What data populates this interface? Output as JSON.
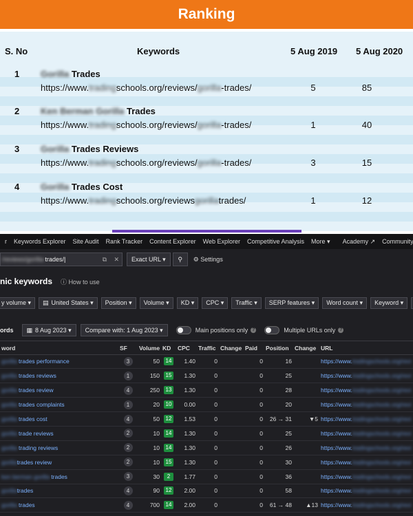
{
  "ranking": {
    "banner": "Ranking",
    "headers": {
      "sno": "S. No",
      "keywords": "Keywords",
      "date1": "5 Aug 2019",
      "date2": "5 Aug 2020"
    },
    "rows": [
      {
        "num": "1",
        "kw_blur": "Gorilla",
        "kw": "Trades",
        "url1": "https://www.",
        "url_blur1": "trading",
        "url2": "schools.org/reviews/",
        "url_blur2": "gorilla",
        "url3": "-trades/",
        "v2019": "5",
        "v2020": "85"
      },
      {
        "num": "2",
        "kw_blur": "Ken Berman Gorilla",
        "kw": "Trades",
        "url1": "https://www.",
        "url_blur1": "trading",
        "url2": "schools.org/reviews/",
        "url_blur2": "gorilla",
        "url3": "-trades/",
        "v2019": "1",
        "v2020": "40"
      },
      {
        "num": "3",
        "kw_blur": "Gorilla",
        "kw": "Trades Reviews",
        "url1": "https://www.",
        "url_blur1": "trading",
        "url2": "schools.org/reviews/",
        "url_blur2": "gorilla",
        "url3": "-trades/",
        "v2019": "3",
        "v2020": "15"
      },
      {
        "num": "4",
        "kw_blur": "Gorilla",
        "kw": "Trades Cost",
        "url1": "https://www.",
        "url_blur1": "trading",
        "url2": "schools.org/reviews",
        "url_blur2": "gorilla",
        "url3": "trades/",
        "v2019": "1",
        "v2020": "12"
      }
    ]
  },
  "nav": {
    "items": [
      "r",
      "Keywords Explorer",
      "Site Audit",
      "Rank Tracker",
      "Content Explorer",
      "Web Explorer",
      "Competitive Analysis",
      "More ▾",
      "Academy ↗",
      "Community ↗"
    ]
  },
  "search": {
    "value_blur": "/reviews/gorilla-",
    "value": "trades/",
    "mode": "Exact URL ▾",
    "settings": "Settings"
  },
  "page": {
    "title": "nic keywords",
    "howto": "How to use"
  },
  "filters": [
    "y volume ▾",
    "United States ▾",
    "Position ▾",
    "Volume ▾",
    "KD ▾",
    "CPC ▾",
    "Traffic ▾",
    "SERP features ▾",
    "Word count ▾",
    "Keyword ▾",
    "U"
  ],
  "toolbar": {
    "label": "ords",
    "date": "8 Aug 2023 ▾",
    "compare": "Compare with: 1 Aug 2023 ▾",
    "main_positions": "Main positions only",
    "multiple_urls": "Multiple URLs only"
  },
  "table": {
    "columns": [
      "word",
      "SF",
      "Volume",
      "KD",
      "CPC",
      "Traffic",
      "Change",
      "Paid",
      "Position",
      "Change",
      "URL"
    ],
    "url_prefix": "https://www.",
    "url_blur": "tradingschools.org/revi",
    "rows": [
      {
        "kw_blur": "gorilla",
        "kw": " trades performance",
        "sf": "3",
        "volume": "50",
        "kd": "14",
        "kd_color": "#1e8f3e",
        "cpc": "1.40",
        "traffic": "0",
        "paid": "0",
        "position": "16",
        "change": ""
      },
      {
        "kw_blur": "gorilla",
        "kw": " trades reviews",
        "sf": "1",
        "volume": "150",
        "kd": "15",
        "kd_color": "#1e8f3e",
        "cpc": "1.30",
        "traffic": "0",
        "paid": "0",
        "position": "25",
        "change": ""
      },
      {
        "kw_blur": "gorilla",
        "kw": " trades review",
        "sf": "4",
        "volume": "250",
        "kd": "13",
        "kd_color": "#1e8f3e",
        "cpc": "1.30",
        "traffic": "0",
        "paid": "0",
        "position": "28",
        "change": ""
      },
      {
        "kw_blur": "gorilla",
        "kw": " trades complaints",
        "sf": "1",
        "volume": "20",
        "kd": "10",
        "kd_color": "#1e8f3e",
        "cpc": "0.00",
        "traffic": "0",
        "paid": "0",
        "position": "20",
        "change": ""
      },
      {
        "kw_blur": "gorilla",
        "kw": " trades cost",
        "sf": "4",
        "volume": "50",
        "kd": "12",
        "kd_color": "#1e8f3e",
        "cpc": "1.53",
        "traffic": "0",
        "paid": "0",
        "position": "26 → 31",
        "change": "▼5",
        "change_dir": "down"
      },
      {
        "kw_blur": "gorilla",
        "kw": " trade reviews",
        "sf": "2",
        "volume": "10",
        "kd": "14",
        "kd_color": "#1e8f3e",
        "cpc": "1.30",
        "traffic": "0",
        "paid": "0",
        "position": "25",
        "change": ""
      },
      {
        "kw_blur": "gorilla",
        "kw": " trading reviews",
        "sf": "2",
        "volume": "10",
        "kd": "14",
        "kd_color": "#1e8f3e",
        "cpc": "1.30",
        "traffic": "0",
        "paid": "0",
        "position": "26",
        "change": ""
      },
      {
        "kw_blur": "gorilla",
        "kw": "trades review",
        "sf": "2",
        "volume": "10",
        "kd": "15",
        "kd_color": "#1e8f3e",
        "cpc": "1.30",
        "traffic": "0",
        "paid": "0",
        "position": "30",
        "change": ""
      },
      {
        "kw_blur": "ken berman gorilla",
        "kw": " trades",
        "sf": "3",
        "volume": "30",
        "kd": "2",
        "kd_color": "#1e8f3e",
        "cpc": "1.77",
        "traffic": "0",
        "paid": "0",
        "position": "36",
        "change": ""
      },
      {
        "kw_blur": "gorilla",
        "kw": "trades",
        "sf": "4",
        "volume": "90",
        "kd": "12",
        "kd_color": "#1e8f3e",
        "cpc": "2.00",
        "traffic": "0",
        "paid": "0",
        "position": "58",
        "change": ""
      },
      {
        "kw_blur": "gorilla",
        "kw": " trades",
        "sf": "4",
        "volume": "700",
        "kd": "14",
        "kd_color": "#1e8f3e",
        "cpc": "2.00",
        "traffic": "0",
        "paid": "0",
        "position": "61 → 48",
        "change": "▲13",
        "change_dir": "up"
      }
    ]
  }
}
